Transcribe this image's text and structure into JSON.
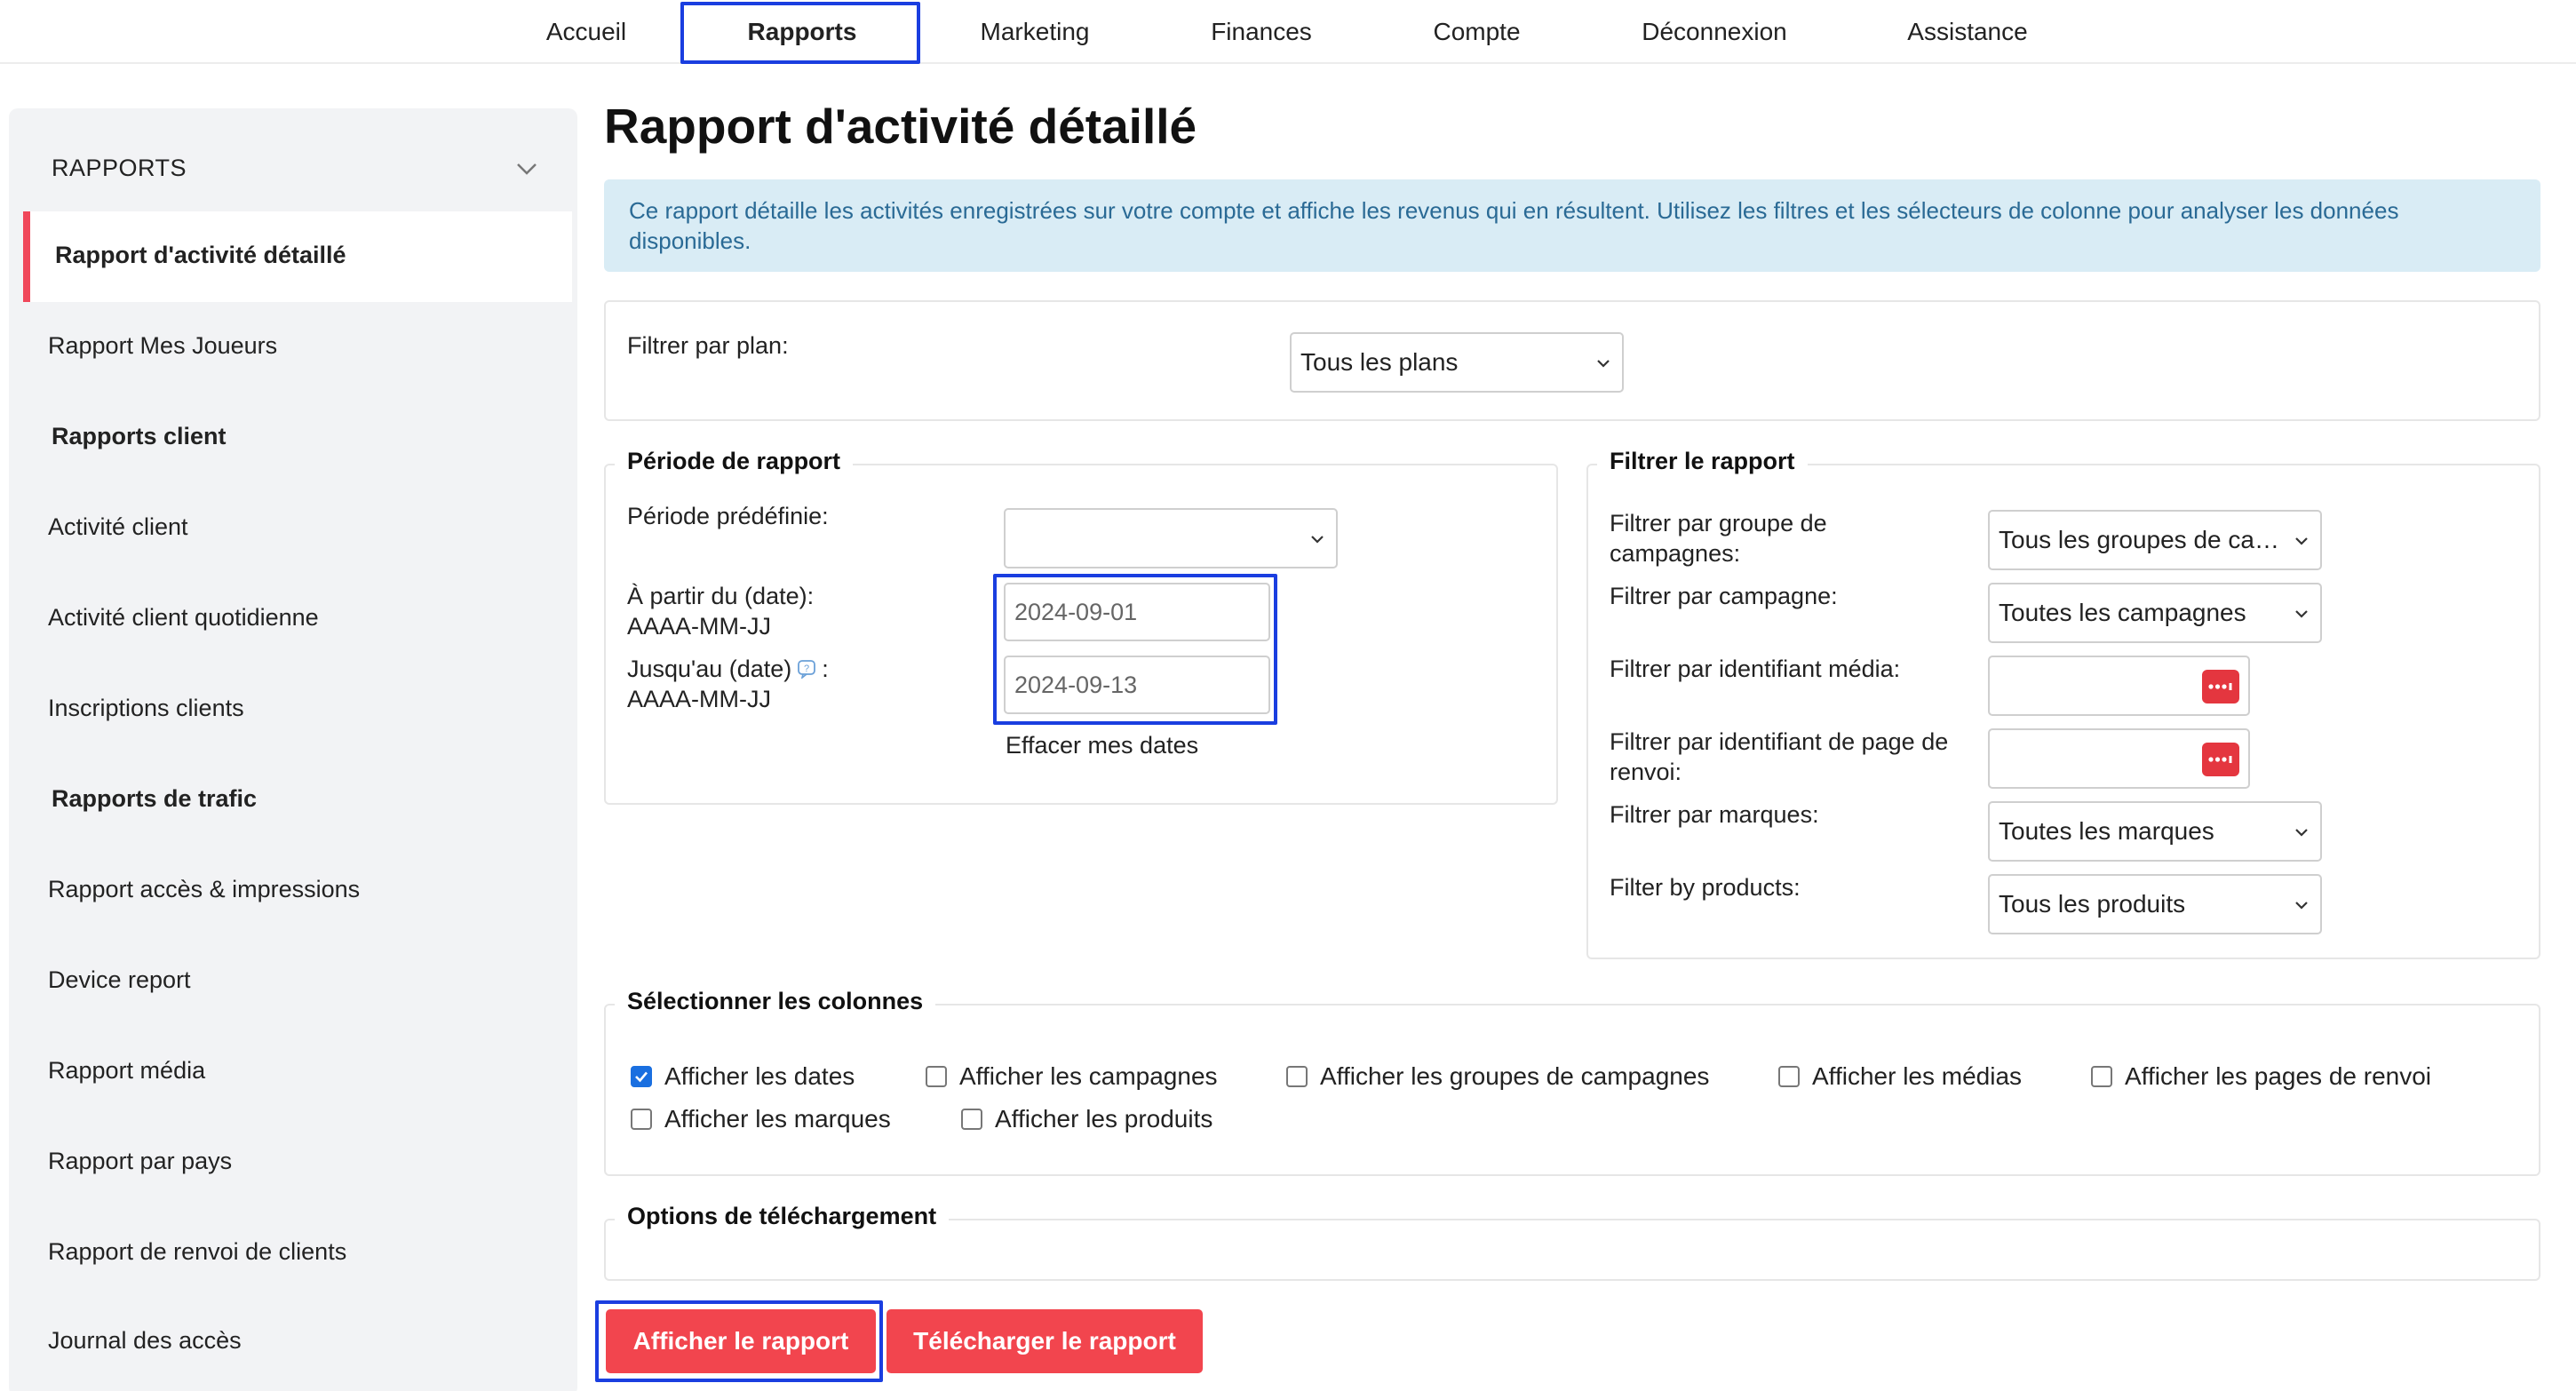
{
  "nav": {
    "items": [
      {
        "label": "Accueil",
        "active": false
      },
      {
        "label": "Rapports",
        "active": true
      },
      {
        "label": "Marketing",
        "active": false
      },
      {
        "label": "Finances",
        "active": false
      },
      {
        "label": "Compte",
        "active": false
      },
      {
        "label": "Déconnexion",
        "active": false
      },
      {
        "label": "Assistance",
        "active": false
      }
    ]
  },
  "sidebar": {
    "header": "RAPPORTS",
    "items": [
      {
        "label": "Rapport d'activité détaillé",
        "type": "active"
      },
      {
        "label": "Rapport Mes Joueurs",
        "type": "link"
      },
      {
        "label": "Rapports client",
        "type": "group"
      },
      {
        "label": "Activité client",
        "type": "link"
      },
      {
        "label": "Activité client quotidienne",
        "type": "link"
      },
      {
        "label": "Inscriptions clients",
        "type": "link"
      },
      {
        "label": "Rapports de trafic",
        "type": "group"
      },
      {
        "label": "Rapport accès & impressions",
        "type": "link"
      },
      {
        "label": "Device report",
        "type": "link"
      },
      {
        "label": "Rapport média",
        "type": "link"
      },
      {
        "label": "Rapport par pays",
        "type": "link"
      },
      {
        "label": "Rapport de renvoi de clients",
        "type": "link"
      },
      {
        "label": "Journal des accès",
        "type": "link"
      }
    ]
  },
  "main": {
    "title": "Rapport d'activité détaillé",
    "info": "Ce rapport détaille les activités enregistrées sur votre compte et affiche les revenus qui en résultent. Utilisez les filtres et les sélecteurs de colonne pour analyser les données disponibles.",
    "plan_filter": {
      "label": "Filtrer par plan:",
      "value": "Tous les plans"
    },
    "period": {
      "legend": "Période de rapport",
      "preset_label": "Période prédéfinie:",
      "preset_value": "",
      "from_label_1": "À partir du (date):",
      "from_label_2": "AAAA-MM-JJ",
      "from_value": "2024-09-01",
      "to_label_1": "Jusqu'au (date)",
      "to_label_colon": ":",
      "to_label_2": "AAAA-MM-JJ",
      "to_value": "2024-09-13",
      "clear_link": "Effacer mes dates"
    },
    "filters": {
      "legend": "Filtrer le rapport",
      "campaign_group_label_1": "Filtrer par groupe de",
      "campaign_group_label_2": "campagnes:",
      "campaign_group_value": "Tous les groupes de ca…",
      "campaign_label": "Filtrer par campagne:",
      "campaign_value": "Toutes les campagnes",
      "media_label": "Filtrer par identifiant média:",
      "referrer_label_1": "Filtrer par identifiant de page de",
      "referrer_label_2": "renvoi:",
      "brands_label": "Filtrer par marques:",
      "brands_value": "Toutes les marques",
      "products_label": "Filter by products:",
      "products_value": "Tous les produits"
    },
    "columns": {
      "legend": "Sélectionner les colonnes",
      "options": [
        {
          "label": "Afficher les dates",
          "checked": true
        },
        {
          "label": "Afficher les campagnes",
          "checked": false
        },
        {
          "label": "Afficher les groupes de campagnes",
          "checked": false
        },
        {
          "label": "Afficher les médias",
          "checked": false
        },
        {
          "label": "Afficher les pages de renvoi",
          "checked": false
        },
        {
          "label": "Afficher les marques",
          "checked": false
        },
        {
          "label": "Afficher les produits",
          "checked": false
        }
      ]
    },
    "download": {
      "legend": "Options de téléchargement"
    },
    "buttons": {
      "show": "Afficher le rapport",
      "download": "Télécharger le rapport"
    }
  },
  "colors": {
    "accent_red": "#f2454e",
    "highlight_blue": "#1a3ee0",
    "info_bg": "#d9ecf5",
    "info_text": "#2a6a95",
    "checkbox_blue": "#1a6fe0"
  }
}
